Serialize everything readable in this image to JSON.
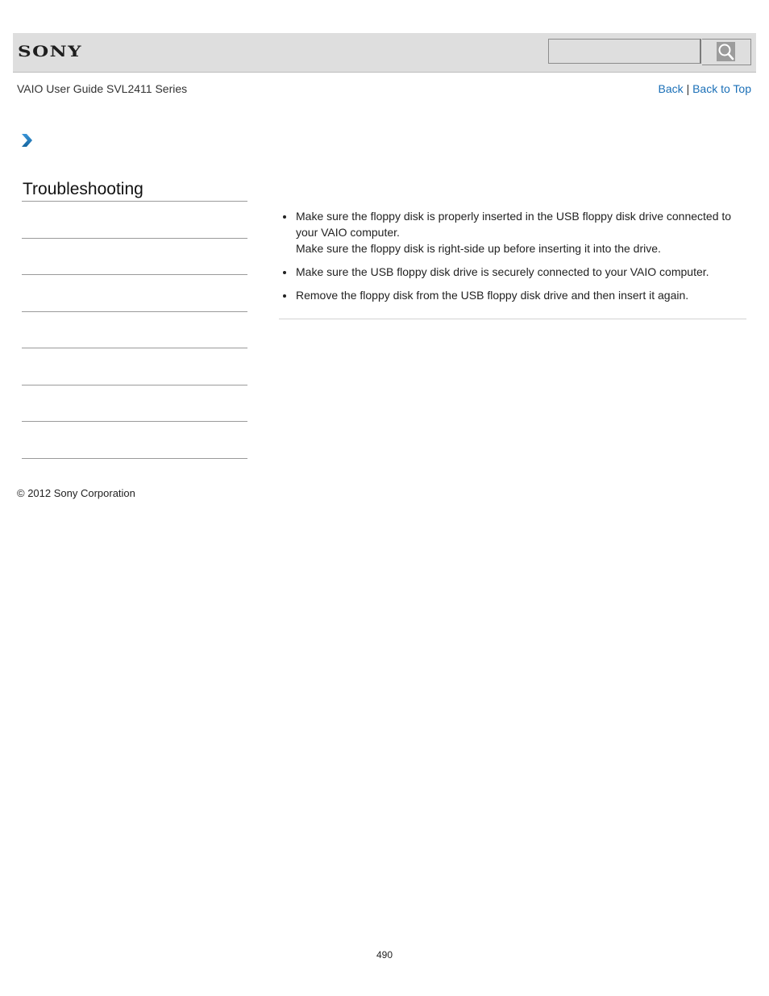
{
  "header": {
    "logo_text": "SONY",
    "search": {
      "value": "",
      "placeholder": "",
      "button_icon": "search-icon"
    }
  },
  "subheader": {
    "title": "VAIO User Guide SVL2411 Series",
    "links": {
      "back": "Back",
      "separator": "|",
      "back_to_top": "Back to Top"
    }
  },
  "breadcrumb": {
    "icon": "chevron-right-icon"
  },
  "sidebar": {
    "title": "Troubleshooting",
    "items": [
      {
        "label": ""
      },
      {
        "label": ""
      },
      {
        "label": ""
      },
      {
        "label": ""
      },
      {
        "label": ""
      },
      {
        "label": ""
      },
      {
        "label": ""
      }
    ]
  },
  "content": {
    "bullets": [
      {
        "text": "Make sure the floppy disk is properly inserted in the USB floppy disk drive connected to your VAIO computer.",
        "subtext": "Make sure the floppy disk is right-side up before inserting it into the drive."
      },
      {
        "text": "Make sure the USB floppy disk drive is securely connected to your VAIO computer.",
        "subtext": ""
      },
      {
        "text": "Remove the floppy disk from the USB floppy disk drive and then insert it again.",
        "subtext": ""
      }
    ]
  },
  "footer": {
    "copyright": "© 2012 Sony Corporation",
    "page_number": "490"
  },
  "colors": {
    "link": "#1a6fb7",
    "header_bg": "#dedede",
    "chevron": "#1f7cc4"
  }
}
